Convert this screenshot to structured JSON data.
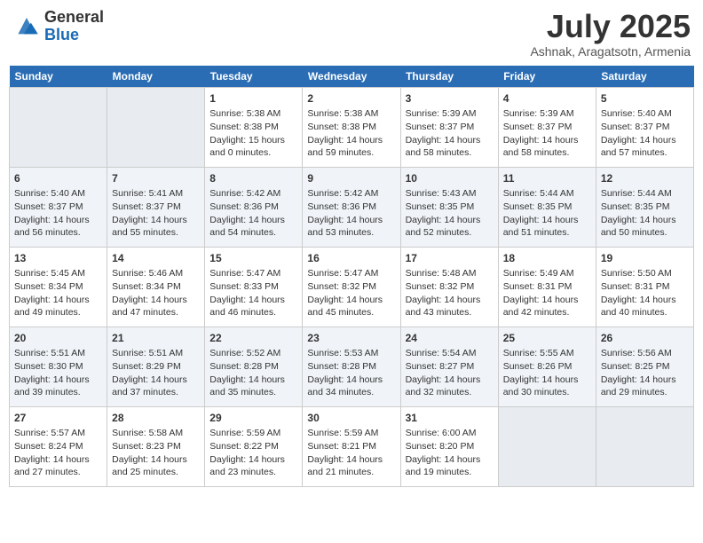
{
  "logo": {
    "general": "General",
    "blue": "Blue"
  },
  "title": "July 2025",
  "location": "Ashnak, Aragatsotn, Armenia",
  "days_of_week": [
    "Sunday",
    "Monday",
    "Tuesday",
    "Wednesday",
    "Thursday",
    "Friday",
    "Saturday"
  ],
  "weeks": [
    [
      {
        "day": "",
        "sunrise": "",
        "sunset": "",
        "daylight": "",
        "empty": true
      },
      {
        "day": "",
        "sunrise": "",
        "sunset": "",
        "daylight": "",
        "empty": true
      },
      {
        "day": "1",
        "sunrise": "Sunrise: 5:38 AM",
        "sunset": "Sunset: 8:38 PM",
        "daylight": "Daylight: 15 hours and 0 minutes."
      },
      {
        "day": "2",
        "sunrise": "Sunrise: 5:38 AM",
        "sunset": "Sunset: 8:38 PM",
        "daylight": "Daylight: 14 hours and 59 minutes."
      },
      {
        "day": "3",
        "sunrise": "Sunrise: 5:39 AM",
        "sunset": "Sunset: 8:37 PM",
        "daylight": "Daylight: 14 hours and 58 minutes."
      },
      {
        "day": "4",
        "sunrise": "Sunrise: 5:39 AM",
        "sunset": "Sunset: 8:37 PM",
        "daylight": "Daylight: 14 hours and 58 minutes."
      },
      {
        "day": "5",
        "sunrise": "Sunrise: 5:40 AM",
        "sunset": "Sunset: 8:37 PM",
        "daylight": "Daylight: 14 hours and 57 minutes."
      }
    ],
    [
      {
        "day": "6",
        "sunrise": "Sunrise: 5:40 AM",
        "sunset": "Sunset: 8:37 PM",
        "daylight": "Daylight: 14 hours and 56 minutes."
      },
      {
        "day": "7",
        "sunrise": "Sunrise: 5:41 AM",
        "sunset": "Sunset: 8:37 PM",
        "daylight": "Daylight: 14 hours and 55 minutes."
      },
      {
        "day": "8",
        "sunrise": "Sunrise: 5:42 AM",
        "sunset": "Sunset: 8:36 PM",
        "daylight": "Daylight: 14 hours and 54 minutes."
      },
      {
        "day": "9",
        "sunrise": "Sunrise: 5:42 AM",
        "sunset": "Sunset: 8:36 PM",
        "daylight": "Daylight: 14 hours and 53 minutes."
      },
      {
        "day": "10",
        "sunrise": "Sunrise: 5:43 AM",
        "sunset": "Sunset: 8:35 PM",
        "daylight": "Daylight: 14 hours and 52 minutes."
      },
      {
        "day": "11",
        "sunrise": "Sunrise: 5:44 AM",
        "sunset": "Sunset: 8:35 PM",
        "daylight": "Daylight: 14 hours and 51 minutes."
      },
      {
        "day": "12",
        "sunrise": "Sunrise: 5:44 AM",
        "sunset": "Sunset: 8:35 PM",
        "daylight": "Daylight: 14 hours and 50 minutes."
      }
    ],
    [
      {
        "day": "13",
        "sunrise": "Sunrise: 5:45 AM",
        "sunset": "Sunset: 8:34 PM",
        "daylight": "Daylight: 14 hours and 49 minutes."
      },
      {
        "day": "14",
        "sunrise": "Sunrise: 5:46 AM",
        "sunset": "Sunset: 8:34 PM",
        "daylight": "Daylight: 14 hours and 47 minutes."
      },
      {
        "day": "15",
        "sunrise": "Sunrise: 5:47 AM",
        "sunset": "Sunset: 8:33 PM",
        "daylight": "Daylight: 14 hours and 46 minutes."
      },
      {
        "day": "16",
        "sunrise": "Sunrise: 5:47 AM",
        "sunset": "Sunset: 8:32 PM",
        "daylight": "Daylight: 14 hours and 45 minutes."
      },
      {
        "day": "17",
        "sunrise": "Sunrise: 5:48 AM",
        "sunset": "Sunset: 8:32 PM",
        "daylight": "Daylight: 14 hours and 43 minutes."
      },
      {
        "day": "18",
        "sunrise": "Sunrise: 5:49 AM",
        "sunset": "Sunset: 8:31 PM",
        "daylight": "Daylight: 14 hours and 42 minutes."
      },
      {
        "day": "19",
        "sunrise": "Sunrise: 5:50 AM",
        "sunset": "Sunset: 8:31 PM",
        "daylight": "Daylight: 14 hours and 40 minutes."
      }
    ],
    [
      {
        "day": "20",
        "sunrise": "Sunrise: 5:51 AM",
        "sunset": "Sunset: 8:30 PM",
        "daylight": "Daylight: 14 hours and 39 minutes."
      },
      {
        "day": "21",
        "sunrise": "Sunrise: 5:51 AM",
        "sunset": "Sunset: 8:29 PM",
        "daylight": "Daylight: 14 hours and 37 minutes."
      },
      {
        "day": "22",
        "sunrise": "Sunrise: 5:52 AM",
        "sunset": "Sunset: 8:28 PM",
        "daylight": "Daylight: 14 hours and 35 minutes."
      },
      {
        "day": "23",
        "sunrise": "Sunrise: 5:53 AM",
        "sunset": "Sunset: 8:28 PM",
        "daylight": "Daylight: 14 hours and 34 minutes."
      },
      {
        "day": "24",
        "sunrise": "Sunrise: 5:54 AM",
        "sunset": "Sunset: 8:27 PM",
        "daylight": "Daylight: 14 hours and 32 minutes."
      },
      {
        "day": "25",
        "sunrise": "Sunrise: 5:55 AM",
        "sunset": "Sunset: 8:26 PM",
        "daylight": "Daylight: 14 hours and 30 minutes."
      },
      {
        "day": "26",
        "sunrise": "Sunrise: 5:56 AM",
        "sunset": "Sunset: 8:25 PM",
        "daylight": "Daylight: 14 hours and 29 minutes."
      }
    ],
    [
      {
        "day": "27",
        "sunrise": "Sunrise: 5:57 AM",
        "sunset": "Sunset: 8:24 PM",
        "daylight": "Daylight: 14 hours and 27 minutes."
      },
      {
        "day": "28",
        "sunrise": "Sunrise: 5:58 AM",
        "sunset": "Sunset: 8:23 PM",
        "daylight": "Daylight: 14 hours and 25 minutes."
      },
      {
        "day": "29",
        "sunrise": "Sunrise: 5:59 AM",
        "sunset": "Sunset: 8:22 PM",
        "daylight": "Daylight: 14 hours and 23 minutes."
      },
      {
        "day": "30",
        "sunrise": "Sunrise: 5:59 AM",
        "sunset": "Sunset: 8:21 PM",
        "daylight": "Daylight: 14 hours and 21 minutes."
      },
      {
        "day": "31",
        "sunrise": "Sunrise: 6:00 AM",
        "sunset": "Sunset: 8:20 PM",
        "daylight": "Daylight: 14 hours and 19 minutes."
      },
      {
        "day": "",
        "sunrise": "",
        "sunset": "",
        "daylight": "",
        "empty": true
      },
      {
        "day": "",
        "sunrise": "",
        "sunset": "",
        "daylight": "",
        "empty": true
      }
    ]
  ]
}
